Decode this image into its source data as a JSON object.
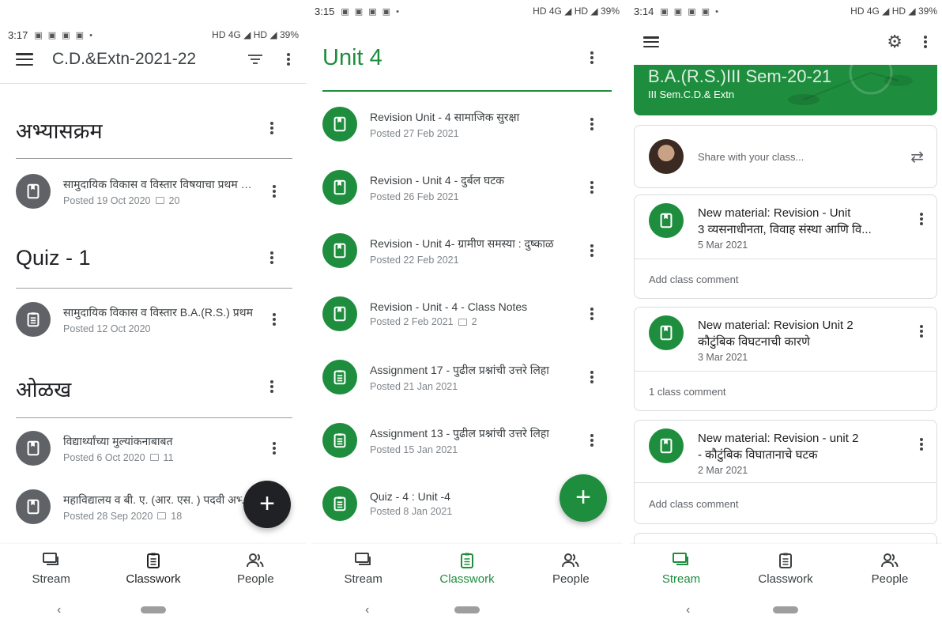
{
  "panel1": {
    "status": {
      "time": "3:17",
      "right": "HD 4G ◢ HD ◢ 39%"
    },
    "title": "C.D.&Extn-2021-22",
    "sections": [
      {
        "title": "अभ्यासक्रम",
        "items": [
          {
            "title": "सामुदायिक विकास व विस्तार विषयाचा प्रथम वर्ष",
            "date": "Posted 19 Oct 2020",
            "comments": "20",
            "type": "material"
          }
        ]
      },
      {
        "title": "Quiz - 1",
        "items": [
          {
            "title": "सामुदायिक विकास व विस्तार  B.A.(R.S.) प्रथम",
            "date": "Posted 12 Oct 2020",
            "comments": "",
            "type": "assignment"
          }
        ]
      },
      {
        "title": "ओळख",
        "items": [
          {
            "title": "विद्यार्थ्यांच्या मुल्यांकनाबाबत",
            "date": "Posted 6 Oct 2020",
            "comments": "11",
            "type": "material"
          },
          {
            "title": "महाविद्यालय व बी. ए. (आर. एस. ) पदवी अभ्यासक्रम",
            "date": "Posted 28 Sep 2020",
            "comments": "18",
            "type": "material"
          }
        ]
      }
    ]
  },
  "panel2": {
    "status": {
      "time": "3:15",
      "right": "HD 4G ◢ HD ◢ 39%"
    },
    "title": "Unit 4",
    "items": [
      {
        "title": "Revision Unit - 4 सामाजिक सुरक्षा",
        "date": "Posted 27 Feb 2021",
        "comments": "",
        "type": "material"
      },
      {
        "title": "Revision - Unit 4 - दुर्बल घटक",
        "date": "Posted 26 Feb 2021",
        "comments": "",
        "type": "material"
      },
      {
        "title": "Revision - Unit 4- ग्रामीण समस्या : दुष्काळ",
        "date": "Posted 22 Feb 2021",
        "comments": "",
        "type": "material"
      },
      {
        "title": "Revision - Unit - 4 - Class Notes",
        "date": "Posted 2 Feb 2021",
        "comments": "2",
        "type": "material"
      },
      {
        "title": "Assignment 17 - पुढील प्रश्नांची उत्तरे लिहा",
        "date": "Posted 21 Jan 2021",
        "comments": "",
        "type": "assignment"
      },
      {
        "title": "Assignment 13 - पुढील प्रश्नांची उत्तरे लिहा",
        "date": "Posted 15 Jan 2021",
        "comments": "",
        "type": "assignment"
      },
      {
        "title": "Quiz - 4 : Unit -4",
        "date": "Posted 8 Jan 2021",
        "comments": "",
        "type": "assignment"
      }
    ]
  },
  "panel3": {
    "status": {
      "time": "3:14",
      "right": "HD 4G ◢ HD ◢ 39%"
    },
    "banner_title": "B.A.(R.S.)III Sem-20-21",
    "banner_subtitle": "III Sem.C.D.& Extn",
    "share_placeholder": "Share with your class...",
    "posts": [
      {
        "title_line1": "New material: Revision - Unit",
        "title_line2": "3 व्यसनाधीनता, विवाह संस्था आणि वि...",
        "date": "5 Mar 2021",
        "comment": "Add class comment"
      },
      {
        "title_line1": "New material: Revision Unit 2",
        "title_line2": "कौटुंबिक विघटनाची कारणे",
        "date": "3 Mar 2021",
        "comment": "1 class comment"
      },
      {
        "title_line1": "New material: Revision - unit 2",
        "title_line2": "- कौटुंबिक विघातानाचे घटक",
        "date": "2 Mar 2021",
        "comment": "Add class comment"
      }
    ]
  },
  "nav": {
    "stream": "Stream",
    "classwork": "Classwork",
    "people": "People"
  },
  "colors": {
    "accent": "#1e8e3e",
    "grey_badge": "#5f6368",
    "fab_dark": "#202124"
  }
}
